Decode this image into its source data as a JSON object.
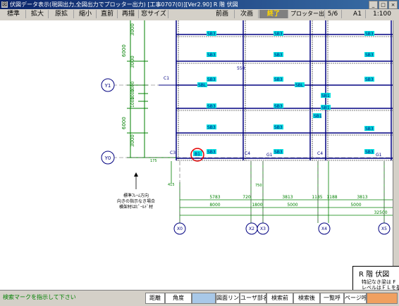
{
  "window": {
    "title": "伏図データ表示(現図出力,全図出力でプロッター出力) [工事0707(0)][Ver2.90] R 階  伏図",
    "icon": "app-icon",
    "controls": [
      "_",
      "□",
      "×"
    ]
  },
  "toolbar": {
    "left": [
      "標準",
      "拡大",
      "原拡",
      "縮小",
      "直前",
      "再描",
      "窓サイズ"
    ],
    "prev": "前画",
    "next": "次画",
    "end": "終了",
    "plotter": "プロッター出力",
    "page": "5/6",
    "paper": "A1",
    "scale": "1:100"
  },
  "drawing": {
    "grid_labels": {
      "y1": "Y1",
      "y0": "Y0",
      "x0": "X0",
      "x2": "X2",
      "x3": "X3",
      "x4": "X4",
      "x5": "X5"
    },
    "members": {
      "sb": "SB1",
      "sb3": "SB3",
      "sbl": "SBL",
      "g1": "G1",
      "c4": "C4",
      "c3": "C3",
      "c1": "C1",
      "b1": "B1"
    },
    "dims_left": [
      "6000",
      "3000",
      "1000",
      "1000",
      "1000",
      "6000",
      "3000",
      "3000"
    ],
    "dims_bottom_row1": [
      "5783",
      "720",
      "3813",
      "1185",
      "1188",
      "3813"
    ],
    "dims_bottom_row2": [
      "8000",
      "1800",
      "5000",
      "5000"
    ],
    "dim_total": "32500",
    "dim_550": "550",
    "dim_175": "175",
    "dim_415": "415",
    "dim_750": "750",
    "note": [
      "標準ﾌﾚｰﾑ方向",
      "向きの指示なき場合",
      "横架材はﾋﾟｰﾙﾄﾞ材"
    ]
  },
  "title_box": {
    "floor": "R 階  伏図",
    "line2": "特記なき梁は F",
    "line3": "レベルはＦＬを基"
  },
  "status": {
    "message": "検索マークを指示して下さい",
    "distance": "距離",
    "angle": "角度",
    "drawing_link": "図面リンク",
    "user_name": "ユーザ部名",
    "search_prev": "検索前",
    "search_next": "検索後",
    "list": "一覧呼",
    "page_call": "ページ呼"
  },
  "colors": {
    "titlebar": "#0a246a",
    "dimension": "#008000",
    "member": "#000080",
    "label_bg": "#00e0e0",
    "highlight_circle": "#e00000"
  }
}
